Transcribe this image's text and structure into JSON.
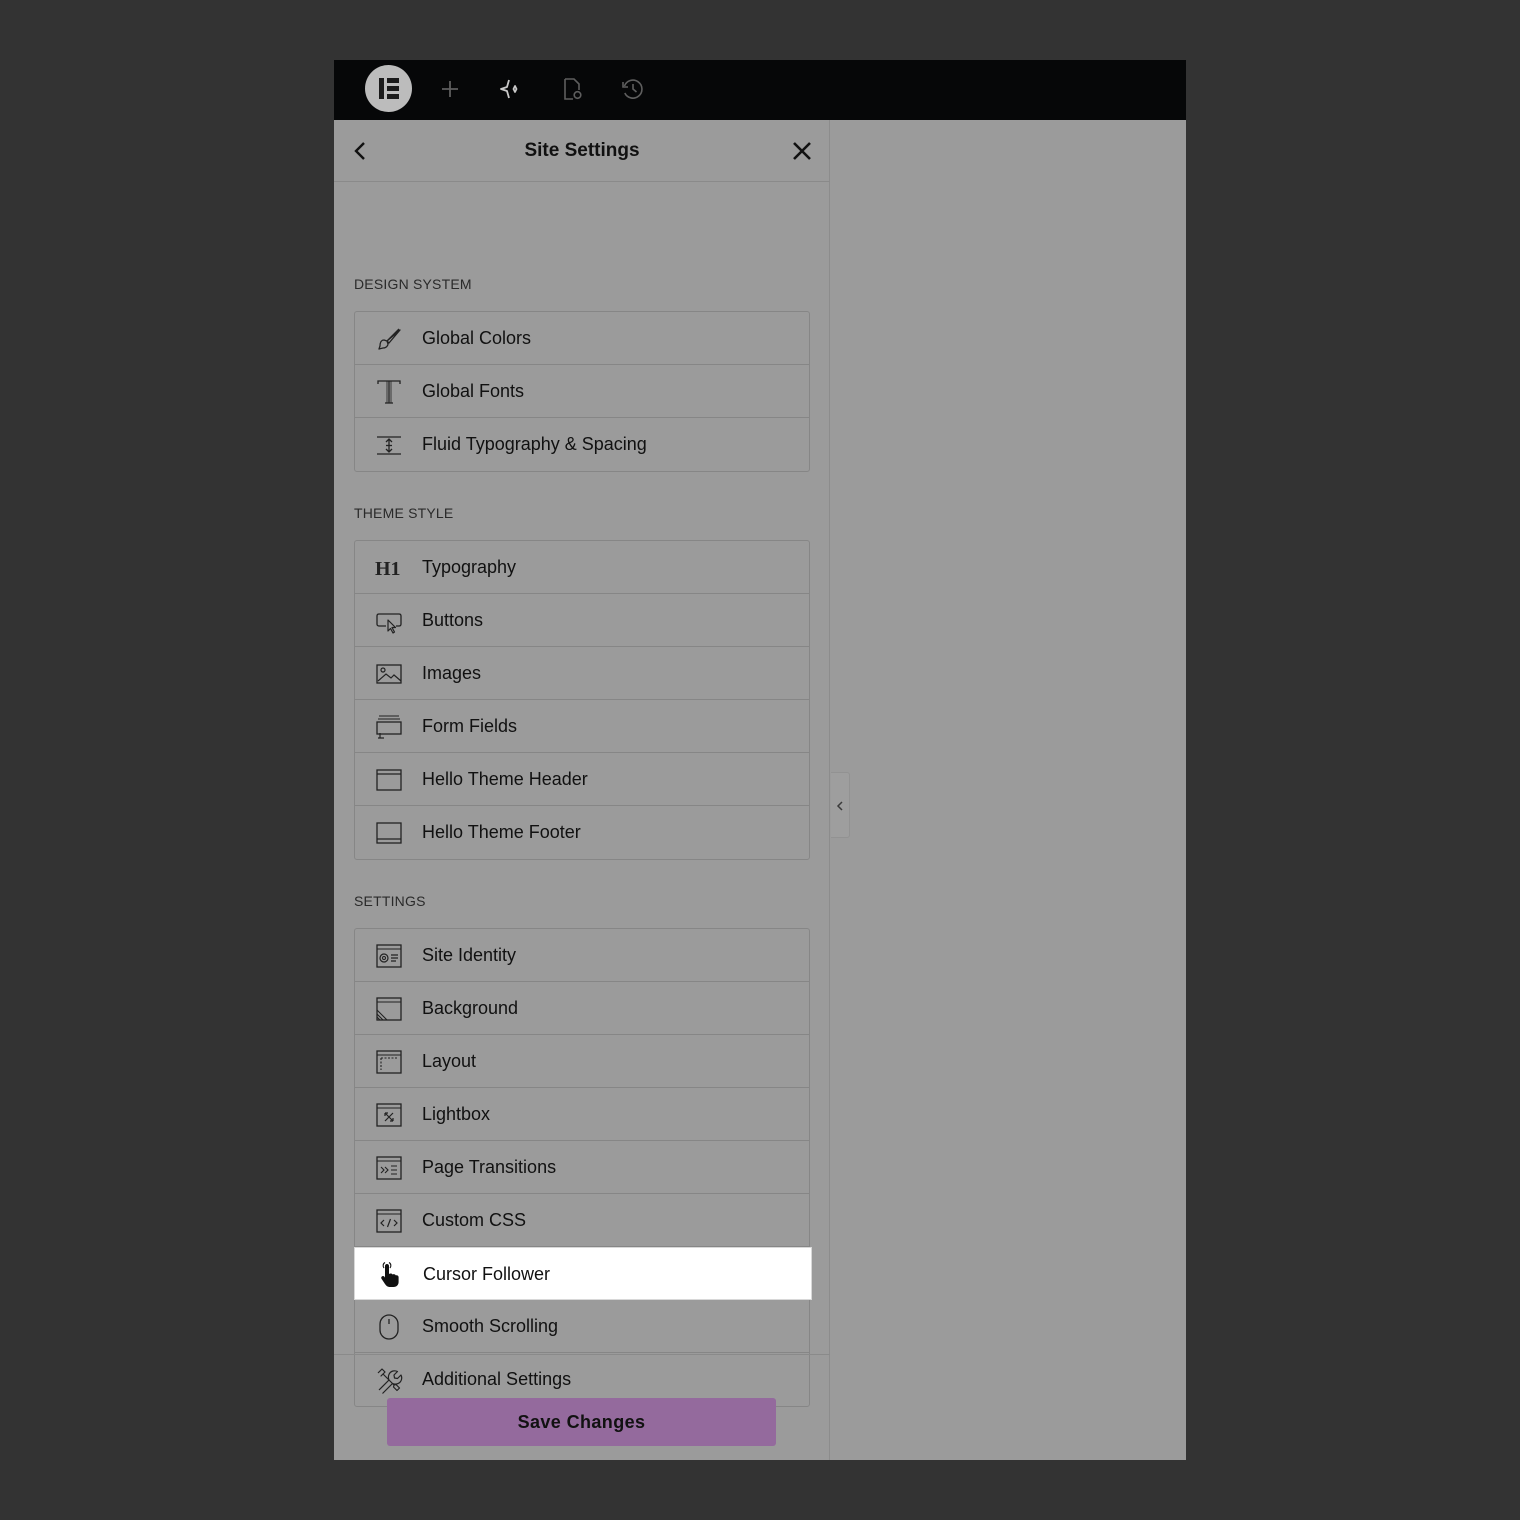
{
  "topbar": {
    "logo_icon": "elementor-logo-icon",
    "buttons": [
      {
        "name": "add-element-button",
        "icon": "plus-icon"
      },
      {
        "name": "ai-button",
        "icon": "sparkle-icon"
      },
      {
        "name": "page-settings-button",
        "icon": "page-settings-icon"
      },
      {
        "name": "history-button",
        "icon": "history-icon"
      }
    ]
  },
  "panel": {
    "title": "Site Settings",
    "back_icon": "chevron-left-icon",
    "close_icon": "close-icon"
  },
  "sections": {
    "design_system": {
      "title": "DESIGN SYSTEM",
      "items": [
        {
          "label": "Global Colors",
          "icon": "brush-icon"
        },
        {
          "label": "Global Fonts",
          "icon": "text-t-icon"
        },
        {
          "label": "Fluid Typography & Spacing",
          "icon": "spacing-icon"
        }
      ]
    },
    "theme_style": {
      "title": "THEME STYLE",
      "items": [
        {
          "label": "Typography",
          "icon": "heading-h1-icon"
        },
        {
          "label": "Buttons",
          "icon": "button-cursor-icon"
        },
        {
          "label": "Images",
          "icon": "image-icon"
        },
        {
          "label": "Form Fields",
          "icon": "form-fields-icon"
        },
        {
          "label": "Hello Theme Header",
          "icon": "header-layout-icon"
        },
        {
          "label": "Hello Theme Footer",
          "icon": "footer-layout-icon"
        }
      ]
    },
    "settings": {
      "title": "SETTINGS",
      "items": [
        {
          "label": "Site Identity",
          "icon": "site-identity-icon"
        },
        {
          "label": "Background",
          "icon": "background-icon"
        },
        {
          "label": "Layout",
          "icon": "layout-icon"
        },
        {
          "label": "Lightbox",
          "icon": "lightbox-icon"
        },
        {
          "label": "Page Transitions",
          "icon": "page-transitions-icon"
        },
        {
          "label": "Custom CSS",
          "icon": "code-icon"
        },
        {
          "label": "Cursor Follower",
          "icon": "hand-pointer-icon",
          "active": true
        },
        {
          "label": "Smooth Scrolling",
          "icon": "mouse-icon"
        },
        {
          "label": "Additional Settings",
          "icon": "tools-icon"
        }
      ]
    }
  },
  "footer": {
    "save_label": "Save Changes",
    "save_color": "#946a9d"
  },
  "colors": {
    "topbar_bg": "#060708",
    "panel_bg": "#9b9b9b",
    "page_bg": "#333333",
    "active_item_bg": "#ffffff"
  }
}
